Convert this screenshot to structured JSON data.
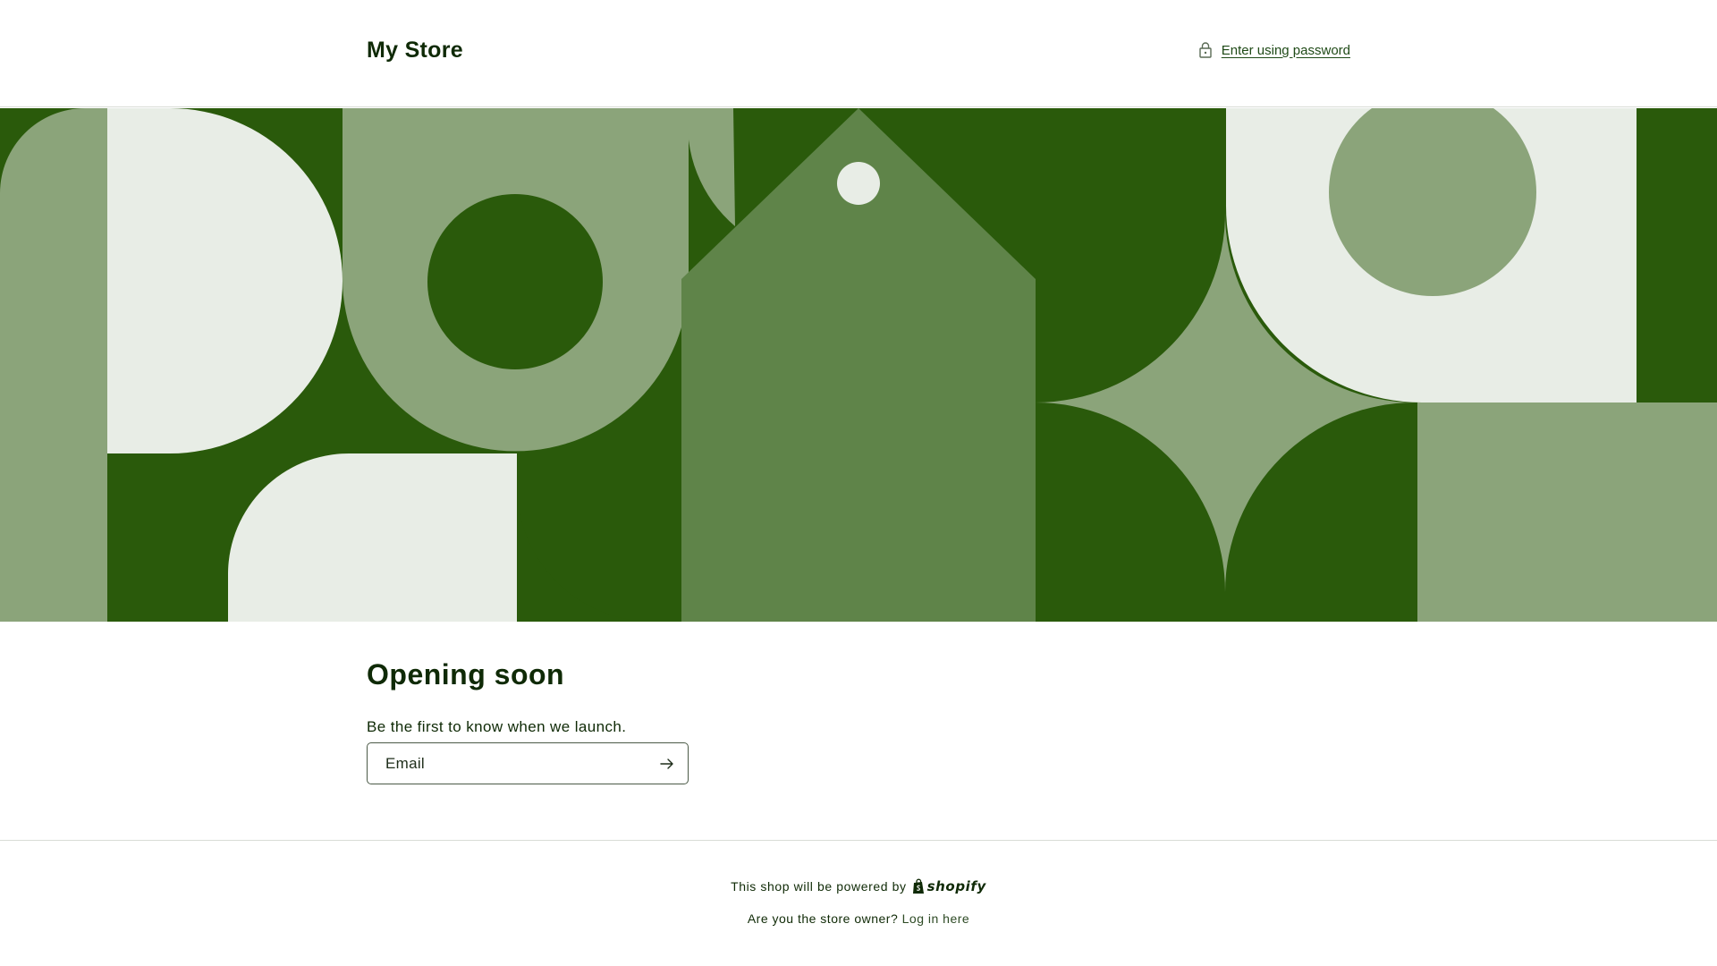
{
  "header": {
    "store_title": "My Store",
    "password_link": "Enter using password",
    "lock_icon": "lock-icon"
  },
  "banner": {
    "colors": {
      "dark_green": "#2a5a0b",
      "sage": "#8ba47a",
      "pale": "#e8ede6",
      "mid_green": "#5f8449"
    }
  },
  "main": {
    "heading": "Opening soon",
    "subtext": "Be the first to know when we launch.",
    "email_placeholder": "Email",
    "submit_icon": "arrow-right-icon"
  },
  "footer": {
    "powered_text": "This shop will be powered by",
    "shopify_label": "shopify",
    "owner_question": "Are you the store owner?",
    "login_link": "Log in here"
  }
}
